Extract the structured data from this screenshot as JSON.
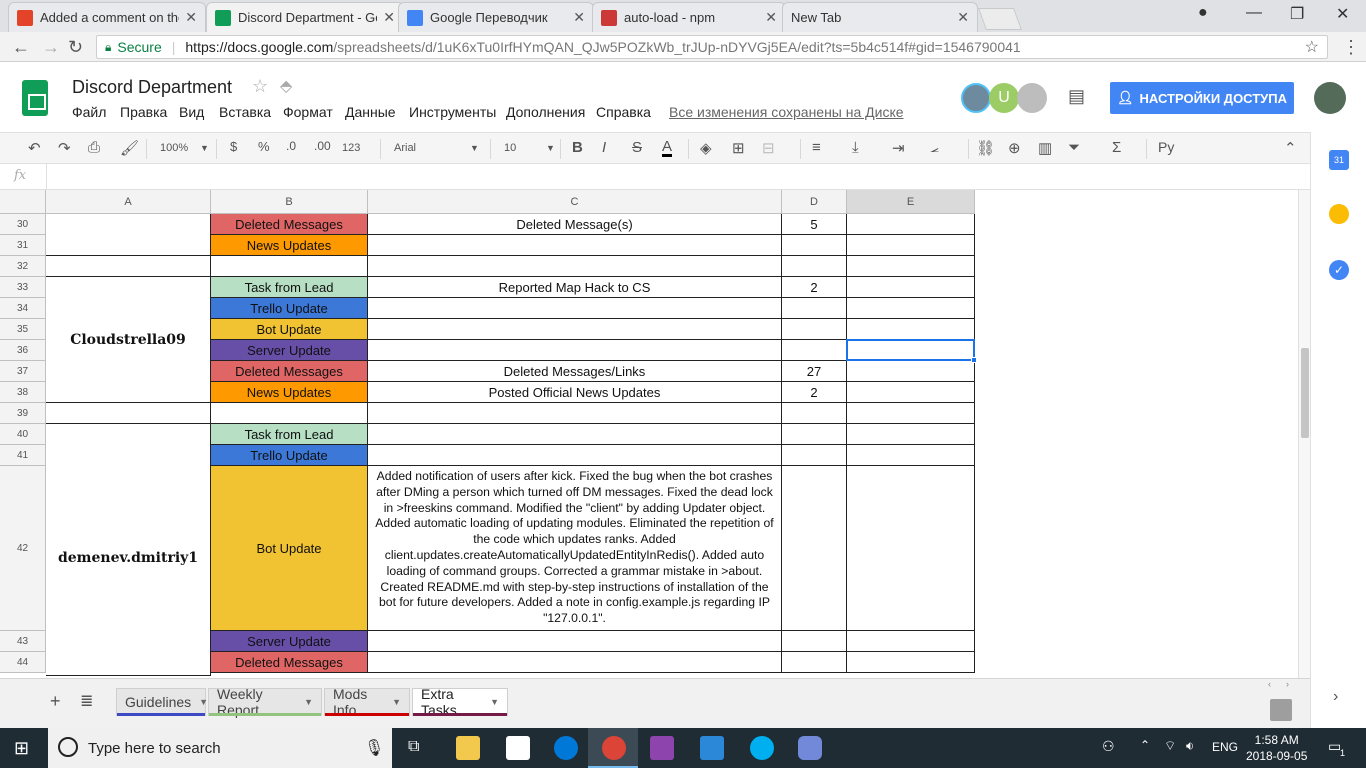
{
  "browser": {
    "tabs": [
      {
        "title": "Added a comment on the",
        "favicon_color": "#e24329"
      },
      {
        "title": "Discord Department - Go",
        "favicon_color": "#0f9d58"
      },
      {
        "title": "Google Переводчик",
        "favicon_color": "#4285f4"
      },
      {
        "title": "auto-load - npm",
        "favicon_color": "#cb3837"
      },
      {
        "title": "New Tab",
        "favicon_color": ""
      }
    ],
    "secure_label": "Secure",
    "url_domain": "https://docs.google.com",
    "url_path": "/spreadsheets/d/1uK6xTu0IrfHYmQAN_QJw5POZkWb_trJUp-nDYVGj5EA/edit?ts=5b4c514f#gid=1546790041"
  },
  "doc": {
    "title": "Discord Department",
    "menus": [
      "Файл",
      "Правка",
      "Вид",
      "Вставка",
      "Формат",
      "Данные",
      "Инструменты",
      "Дополнения",
      "Справка"
    ],
    "saved_status": "Все изменения сохранены на Диске",
    "share_label": "НАСТРОЙКИ ДОСТУПА",
    "avatar_letter": "U"
  },
  "toolbar": {
    "zoom": "100%",
    "currency": "$",
    "percent": "%",
    "dec_less": ".0",
    "dec_more": ".00",
    "format_more": "123",
    "font": "Arial",
    "font_size": "10",
    "input_tools": "Ру"
  },
  "formula_bar": {
    "fx": "fx",
    "value": ""
  },
  "columns": [
    "A",
    "B",
    "C",
    "D",
    "E"
  ],
  "rows": [
    {
      "num": "30",
      "b": "Deleted Messages",
      "c": "Deleted Message(s)",
      "d": "5"
    },
    {
      "num": "31",
      "b": "News Updates",
      "c": "",
      "d": ""
    },
    {
      "num": "32",
      "b": "",
      "c": "",
      "d": ""
    },
    {
      "num": "33",
      "b": "Task from Lead",
      "c": "Reported Map Hack to CS",
      "d": "2"
    },
    {
      "num": "34",
      "b": "Trello Update",
      "c": "",
      "d": ""
    },
    {
      "num": "35",
      "b": "Bot Update",
      "c": "",
      "d": ""
    },
    {
      "num": "36",
      "b": "Server Update",
      "c": "",
      "d": ""
    },
    {
      "num": "37",
      "b": "Deleted Messages",
      "c": "Deleted Messages/Links",
      "d": "27"
    },
    {
      "num": "38",
      "b": "News Updates",
      "c": "Posted Official News Updates",
      "d": "2"
    },
    {
      "num": "39",
      "b": "",
      "c": "",
      "d": ""
    },
    {
      "num": "40",
      "b": "Task from Lead",
      "c": "",
      "d": ""
    },
    {
      "num": "41",
      "b": "Trello Update",
      "c": "",
      "d": ""
    },
    {
      "num": "42",
      "b": "Bot Update",
      "c": "Added notification of users after kick. Fixed the bug when the bot crashes after DMing a person which turned off DM messages. Fixed the dead lock in >freeskins command. Modified the \"client\" by adding Updater object. Added automatic loading of updating modules. Eliminated the repetition of the code which updates ranks. Added client.updates.createAutomaticallyUpdatedEntityInRedis(). Added auto loading of command groups. Corrected a grammar mistake in >about. Created README.md with step-by-step instructions of installation of the bot for future developers. Added a note in config.example.js regarding IP \"127.0.0.1\".",
      "d": ""
    },
    {
      "num": "43",
      "b": "Server Update",
      "c": "",
      "d": ""
    },
    {
      "num": "44",
      "b": "Deleted Messages",
      "c": "",
      "d": ""
    }
  ],
  "users": [
    "Cloudstrella09",
    "demenev.dmitriy1"
  ],
  "category_colors": {
    "Deleted Messages": "#e06666",
    "News Updates": "#ff9900",
    "Task from Lead": "#b6dfc4",
    "Trello Update": "#3c78d8",
    "Bot Update": "#f1c232",
    "Server Update": "#674ea7"
  },
  "sheet_tabs": [
    {
      "label": "Guidelines",
      "color": "#3c4bc4"
    },
    {
      "label": "Weekly Report",
      "color": "#93c47d"
    },
    {
      "label": "Mods Info",
      "color": "#cc0000"
    },
    {
      "label": "Extra Tasks",
      "color": "#741b47"
    }
  ],
  "taskbar": {
    "search_placeholder": "Type here to search",
    "lang": "ENG",
    "time": "1:58 AM",
    "date": "2018-09-05",
    "notifications": "1"
  }
}
